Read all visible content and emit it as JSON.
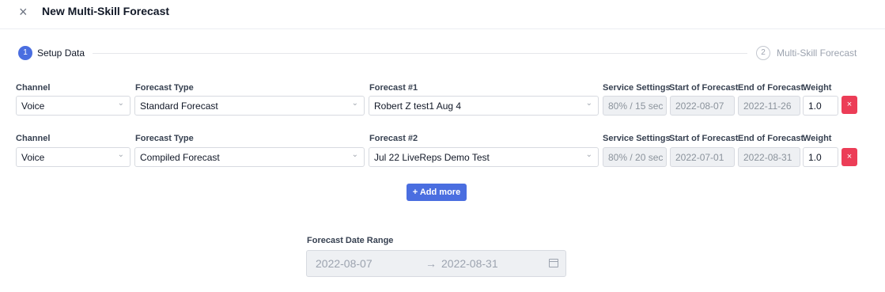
{
  "window": {
    "title": "New Multi-Skill Forecast",
    "close_glyph": "×"
  },
  "steps": [
    {
      "number": "1",
      "label": "Setup Data"
    },
    {
      "number": "2",
      "label": "Multi-Skill Forecast"
    }
  ],
  "columns": {
    "channel": "Channel",
    "forecast_type": "Forecast Type",
    "service_settings": "Service Settings",
    "start": "Start of Forecast",
    "end": "End of Forecast",
    "weight": "Weight"
  },
  "rows": [
    {
      "forecast_label": "Forecast #1",
      "channel": "Voice",
      "forecast_type": "Standard Forecast",
      "forecast": "Robert Z test1 Aug 4",
      "service_settings": "80% / 15 sec",
      "start": "2022-08-07",
      "end": "2022-11-26",
      "weight": "1.0",
      "delete_glyph": "×"
    },
    {
      "forecast_label": "Forecast #2",
      "channel": "Voice",
      "forecast_type": "Compiled Forecast",
      "forecast": "Jul 22 LiveReps Demo Test",
      "service_settings": "80% / 20 sec",
      "start": "2022-07-01",
      "end": "2022-08-31",
      "weight": "1.0",
      "delete_glyph": "×"
    }
  ],
  "add_more_label": "+ Add more",
  "date_range": {
    "label": "Forecast Date Range",
    "start": "2022-08-07",
    "arrow": "→",
    "end": "2022-08-31"
  },
  "colors": {
    "accent": "#4a6ee0",
    "danger": "#ec3d57"
  }
}
